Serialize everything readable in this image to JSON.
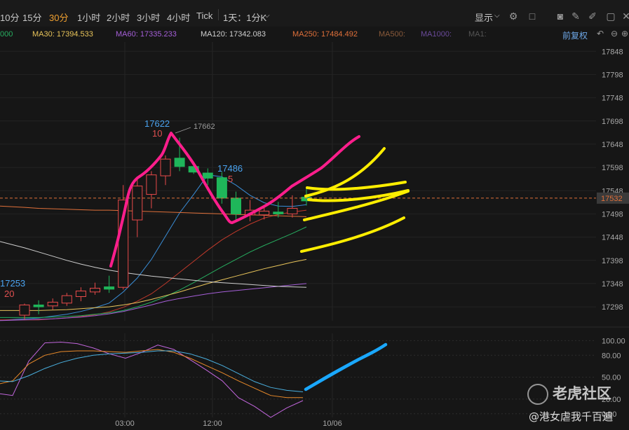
{
  "toolbar": {
    "periods": [
      "10分",
      "15分",
      "30分",
      "1小时",
      "2小时",
      "3小时",
      "4小时",
      "Tick"
    ],
    "active_period": "30分",
    "interval_select": "1天：1分K",
    "display_label": "显示",
    "adjust_label": "前复权"
  },
  "ma_legend": [
    {
      "label": "000",
      "color": "#27ae60"
    },
    {
      "label": "MA30: 17394.533",
      "color": "#e8c45a"
    },
    {
      "label": "MA60: 17335.233",
      "color": "#a55fd8"
    },
    {
      "label": "MA120: 17342.083",
      "color": "#cfcfcf"
    },
    {
      "label": "MA250: 17484.492",
      "color": "#e0703a"
    },
    {
      "label": "MA500:",
      "color": "#8a5a3a"
    },
    {
      "label": "MA1000:",
      "color": "#6a4a9a"
    },
    {
      "label": "MA1:",
      "color": "#555555"
    }
  ],
  "chart_data": [
    {
      "type": "candlestick",
      "x_ticks": [
        "03:00",
        "12:00",
        "10/06"
      ],
      "y_ticks": [
        "17848",
        "17798",
        "17748",
        "17698",
        "17648",
        "17598",
        "17548",
        "17498",
        "17448",
        "17398",
        "17348",
        "17298"
      ],
      "ylim": [
        17268,
        17868
      ],
      "last_price": "17532",
      "candles": [
        {
          "o": 17280,
          "h": 17305,
          "l": 17270,
          "c": 17302
        },
        {
          "o": 17302,
          "h": 17312,
          "l": 17282,
          "c": 17298
        },
        {
          "o": 17300,
          "h": 17316,
          "l": 17292,
          "c": 17308
        },
        {
          "o": 17306,
          "h": 17328,
          "l": 17300,
          "c": 17322
        },
        {
          "o": 17320,
          "h": 17340,
          "l": 17310,
          "c": 17332
        },
        {
          "o": 17330,
          "h": 17350,
          "l": 17324,
          "c": 17338
        },
        {
          "o": 17341,
          "h": 17365,
          "l": 17328,
          "c": 17336
        },
        {
          "o": 17340,
          "h": 17560,
          "l": 17335,
          "c": 17528
        },
        {
          "o": 17485,
          "h": 17572,
          "l": 17448,
          "c": 17558
        },
        {
          "o": 17540,
          "h": 17590,
          "l": 17510,
          "c": 17582
        },
        {
          "o": 17580,
          "h": 17624,
          "l": 17560,
          "c": 17616
        },
        {
          "o": 17618,
          "h": 17662,
          "l": 17590,
          "c": 17600
        },
        {
          "o": 17600,
          "h": 17606,
          "l": 17584,
          "c": 17588
        },
        {
          "o": 17586,
          "h": 17596,
          "l": 17560,
          "c": 17575
        },
        {
          "o": 17576,
          "h": 17588,
          "l": 17520,
          "c": 17532
        },
        {
          "o": 17532,
          "h": 17546,
          "l": 17484,
          "c": 17498
        },
        {
          "o": 17496,
          "h": 17528,
          "l": 17482,
          "c": 17506
        },
        {
          "o": 17496,
          "h": 17514,
          "l": 17486,
          "c": 17504
        },
        {
          "o": 17502,
          "h": 17524,
          "l": 17490,
          "c": 17498
        },
        {
          "o": 17498,
          "h": 17538,
          "l": 17490,
          "c": 17510
        },
        {
          "o": 17534,
          "h": 17556,
          "l": 17516,
          "c": 17526
        }
      ],
      "annotations": [
        {
          "text": "17622",
          "kind": "high_price",
          "color": "#4aa3f0"
        },
        {
          "text": "10",
          "kind": "high_count",
          "color": "#e05050"
        },
        {
          "text": "17662",
          "kind": "peak_label",
          "color": "#9a9a9a"
        },
        {
          "text": "17486",
          "kind": "low_price",
          "color": "#4aa3f0"
        },
        {
          "text": "5",
          "kind": "low_count",
          "color": "#e05050"
        },
        {
          "text": "17253",
          "kind": "start_price",
          "color": "#4aa3f0"
        },
        {
          "text": "20",
          "kind": "start_count",
          "color": "#e05050"
        }
      ],
      "ma_lines": [
        {
          "name": "MA(blue)",
          "color": "#3a8ed8",
          "values": [
            17272,
            17274,
            17278,
            17282,
            17288,
            17296,
            17306,
            17330,
            17360,
            17400,
            17450,
            17500,
            17540,
            17582,
            17578,
            17560,
            17538,
            17522,
            17515,
            17514,
            17518
          ]
        },
        {
          "name": "MA(red)",
          "color": "#c0392b",
          "values": [
            17270,
            17270,
            17272,
            17274,
            17277,
            17281,
            17287,
            17297,
            17310,
            17326,
            17348,
            17372,
            17396,
            17420,
            17442,
            17460,
            17476,
            17489,
            17497,
            17502,
            17506
          ]
        },
        {
          "name": "MA(green)",
          "color": "#27ae60",
          "values": [
            17275,
            17275,
            17276,
            17277,
            17279,
            17282,
            17285,
            17290,
            17298,
            17308,
            17320,
            17334,
            17350,
            17367,
            17384,
            17400,
            17416,
            17430,
            17443,
            17456,
            17470
          ]
        },
        {
          "name": "MA30",
          "color": "#e8c45a",
          "values": [
            17290,
            17290,
            17291,
            17292,
            17294,
            17296,
            17298,
            17302,
            17307,
            17314,
            17322,
            17330,
            17339,
            17348,
            17356,
            17364,
            17372,
            17380,
            17387,
            17394,
            17400
          ]
        },
        {
          "name": "MA60",
          "color": "#a55fd8",
          "values": [
            17270,
            17271,
            17272,
            17274,
            17276,
            17279,
            17283,
            17288,
            17295,
            17302,
            17310,
            17316,
            17321,
            17326,
            17330,
            17333,
            17336,
            17339,
            17342,
            17345,
            17348
          ]
        },
        {
          "name": "MA120",
          "color": "#cfcfcf",
          "values": [
            17425,
            17416,
            17407,
            17398,
            17390,
            17383,
            17377,
            17372,
            17368,
            17364,
            17361,
            17358,
            17355,
            17352,
            17350,
            17348,
            17346,
            17344,
            17342,
            17341,
            17340
          ]
        },
        {
          "name": "MA250",
          "color": "#e0703a",
          "values": [
            17512,
            17510,
            17509,
            17508,
            17507,
            17506,
            17506,
            17505,
            17504,
            17503,
            17502,
            17501,
            17500,
            17499,
            17498,
            17497,
            17496,
            17495,
            17494,
            17493,
            17492
          ]
        }
      ]
    },
    {
      "type": "line",
      "name": "oscillator",
      "y_ticks": [
        "100.00",
        "80.00",
        "50.00",
        "20.00",
        "0.00"
      ],
      "ylim": [
        -5,
        110
      ],
      "series": [
        {
          "color": "#c266dd",
          "values": [
            28,
            25,
            72,
            97,
            98,
            96,
            90,
            82,
            76,
            84,
            94,
            88,
            74,
            60,
            45,
            22,
            10,
            -5,
            8,
            18
          ]
        },
        {
          "color": "#e98a2a",
          "values": [
            40,
            45,
            68,
            80,
            85,
            86,
            86,
            85,
            84,
            86,
            88,
            84,
            76,
            66,
            56,
            45,
            35,
            25,
            22,
            22
          ]
        },
        {
          "color": "#4ab0e0",
          "values": [
            45,
            44,
            52,
            62,
            70,
            76,
            80,
            82,
            83,
            84,
            86,
            86,
            82,
            75,
            66,
            55,
            44,
            36,
            32,
            30
          ]
        }
      ]
    }
  ],
  "watermark": {
    "brand": "老虎社区",
    "author": "@港女虐我千百遍"
  }
}
